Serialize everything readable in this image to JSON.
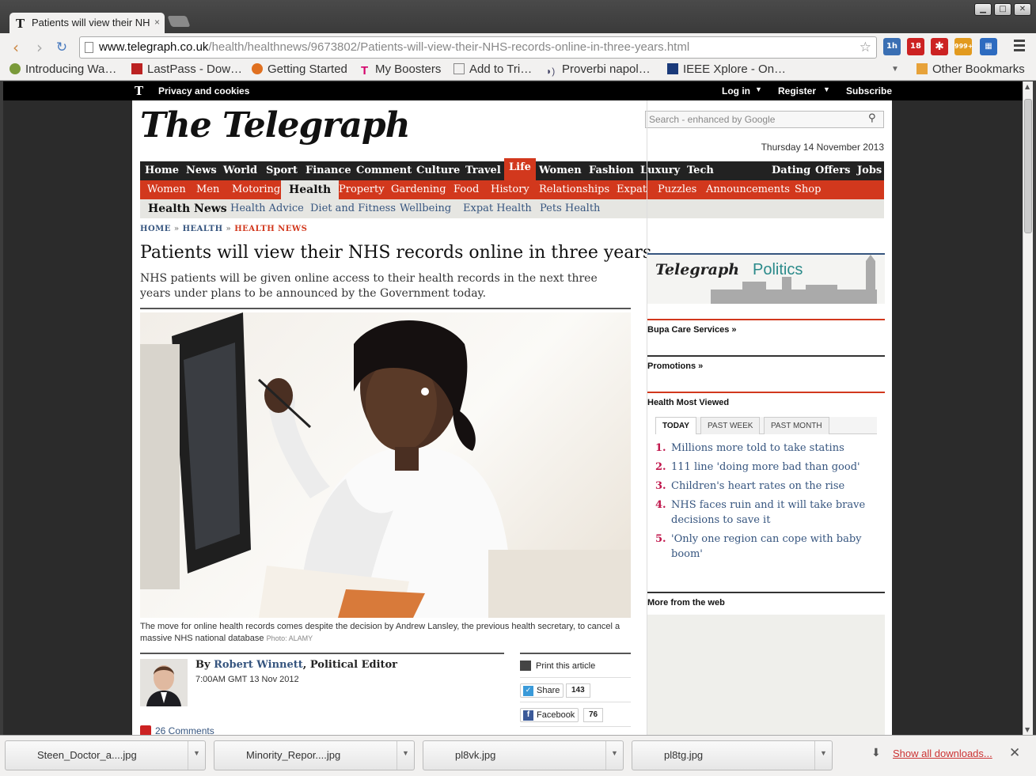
{
  "browser": {
    "tab_title": "Patients will view their NH",
    "tab_close": "×",
    "url_domain": "www.telegraph.co.uk",
    "url_path": "/health/healthnews/9673802/Patients-will-view-their-NHS-records-online-in-three-years.html",
    "ext_badges": [
      "1h",
      "18",
      "999+"
    ],
    "bookmarks": [
      "Introducing Wa…",
      "LastPass - Dow…",
      "Getting Started",
      "My Boosters",
      "Add to Tri…",
      "Proverbi napol…",
      "IEEE Xplore - On…"
    ],
    "other_bookmarks": "Other Bookmarks"
  },
  "site": {
    "privacy": "Privacy and cookies",
    "login": "Log in",
    "register": "Register",
    "subscribe": "Subscribe",
    "logo": "The Telegraph",
    "search_placeholder": "Search - enhanced by Google",
    "date": "Thursday 14 November 2013",
    "nav_main": [
      "Home",
      "News",
      "World",
      "Sport",
      "Finance",
      "Comment",
      "Culture",
      "Travel",
      "Life",
      "Women",
      "Fashion",
      "Luxury",
      "Tech"
    ],
    "nav_main_right": [
      "Dating",
      "Offers",
      "Jobs"
    ],
    "nav_life": [
      "Women",
      "Men",
      "Motoring",
      "Health",
      "Property",
      "Gardening",
      "Food",
      "History",
      "Relationships",
      "Expat",
      "Puzzles",
      "Announcements",
      "Shop"
    ],
    "nav_health": [
      "Health News",
      "Health Advice",
      "Diet and Fitness",
      "Wellbeing",
      "Expat Health",
      "Pets Health"
    ],
    "crumbs": [
      "HOME",
      "HEALTH",
      "HEALTH NEWS"
    ],
    "crumb_sep": "»"
  },
  "article": {
    "headline": "Patients will view their NHS records online in three years",
    "standfirst": "NHS patients will be given online access to their health records in the next three years under plans to be announced by the Government today.",
    "caption": "The move for online health records comes despite the decision by Andrew Lansley, the previous health secretary, to cancel a massive NHS national database",
    "photo_credit": "Photo: ALAMY",
    "by": "By",
    "author": "Robert Winnett",
    "author_role": ", Political Editor",
    "timestamp": "7:00AM GMT 13 Nov 2012",
    "comments": "26 Comments",
    "print": "Print this article",
    "share_label": "Share",
    "share_count": "143",
    "facebook_label": "Facebook",
    "facebook_count": "76"
  },
  "sidebar": {
    "politics_logo": "Telegraph",
    "politics_word": "Politics",
    "bupa": "Bupa Care Services »",
    "promotions": "Promotions »",
    "most_viewed": "Health Most Viewed",
    "tabs": [
      "TODAY",
      "PAST WEEK",
      "PAST MONTH"
    ],
    "items": [
      {
        "n": "1.",
        "t": "Millions more told to take statins"
      },
      {
        "n": "2.",
        "t": "111 line 'doing more bad than good'"
      },
      {
        "n": "3.",
        "t": "Children's heart rates on the rise"
      },
      {
        "n": "4.",
        "t": "NHS faces ruin and it will take brave decisions to save it"
      },
      {
        "n": "5.",
        "t": "'Only one region can cope with baby boom'"
      }
    ],
    "more_web": "More from the web"
  },
  "downloads": {
    "files": [
      "Steen_Doctor_a....jpg",
      "Minority_Repor....jpg",
      "pl8vk.jpg",
      "pl8tg.jpg"
    ],
    "show_all": "Show all downloads..."
  },
  "colors": {
    "accent": "#d2381d",
    "link": "#36557f",
    "number": "#c0164b"
  }
}
